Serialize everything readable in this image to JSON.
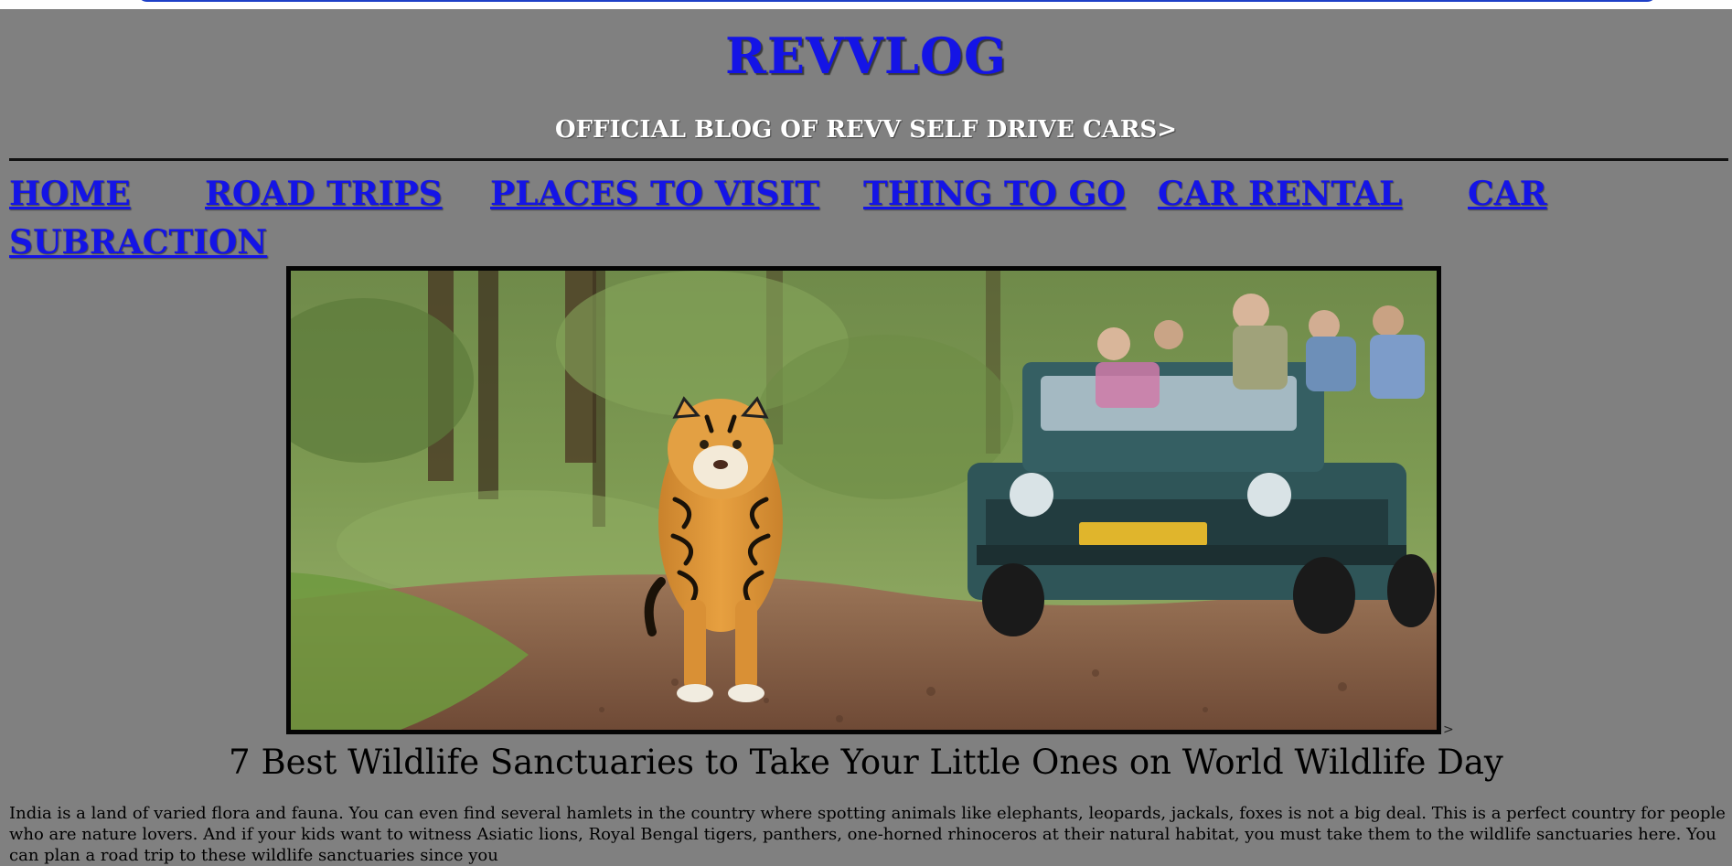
{
  "header": {
    "title": "REVVLOG",
    "tagline": "OFFICIAL BLOG OF REVV SELF DRIVE CARS>"
  },
  "nav": {
    "items": [
      {
        "label": "HOME"
      },
      {
        "label": "ROAD TRIPS"
      },
      {
        "label": "PLACES TO VISIT"
      },
      {
        "label": "THING TO GO"
      },
      {
        "label": "CAR RENTAL"
      },
      {
        "label": "CAR"
      },
      {
        "label": "SUBRACTION"
      }
    ]
  },
  "hero": {
    "image_icon": "tiger-safari-photo"
  },
  "post": {
    "title": "7 Best Wildlife Sanctuaries to Take Your Little Ones on World Wildlife Day",
    "body": "India is a land of varied flora and fauna. You can even find several hamlets in the country where spotting animals like elephants, leopards, jackals, foxes is not a big deal. This is a perfect country for people who are nature lovers. And if your kids want to witness Asiatic lions, Royal Bengal tigers, panthers, one-horned rhinoceros at their natural habitat, you must take them to the wildlife sanctuaries here. You can plan a road trip to these wildlife sanctuaries since you"
  },
  "colors": {
    "background": "#808080",
    "link": "#1414e6",
    "tagline": "#ffffff"
  }
}
